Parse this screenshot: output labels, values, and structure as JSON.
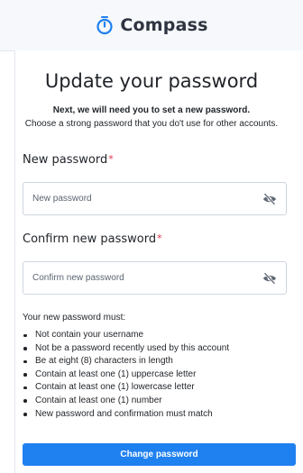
{
  "header": {
    "brand": "Compass",
    "logo_icon": "compass-clock-icon",
    "brand_color": "#1f80f0"
  },
  "form": {
    "title": "Update your password",
    "subtitle_bold": "Next, we will need you to set a new password.",
    "subtitle": "Choose a strong password that you do't use for other accounts.",
    "new_password": {
      "label": "New password",
      "required_marker": "*",
      "placeholder": "New password",
      "value": "",
      "toggle_icon": "eye-slash-icon"
    },
    "confirm_password": {
      "label": "Confirm new password",
      "required_marker": "*",
      "placeholder": "Confirm new password",
      "value": "",
      "toggle_icon": "eye-slash-icon"
    },
    "rules_intro": "Your new password must:",
    "rules": [
      "Not contain your username",
      "Not be a password recently used by this account",
      "Be at eight (8) characters in length",
      "Contain at least one (1) uppercase letter",
      "Contain at least one (1) lowercase letter",
      "Contain at least one (1) number",
      "New password and confirmation must match"
    ],
    "submit_label": "Change password"
  },
  "colors": {
    "accent": "#1f80f0",
    "required": "#e0324b",
    "header_bg": "#f6f8fb"
  }
}
